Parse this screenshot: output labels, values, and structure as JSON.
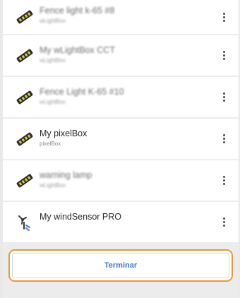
{
  "devices": [
    {
      "name": "Fence light k-65 #8",
      "type": "wLightBox",
      "icon": "led-strip-icon",
      "blurred": true
    },
    {
      "name": "My wLightBox CCT",
      "type": "wLightBox",
      "icon": "led-strip-icon",
      "blurred": true
    },
    {
      "name": "Fence Light K-65 #10",
      "type": "wLightBox",
      "icon": "led-strip-icon",
      "blurred": true
    },
    {
      "name": "My pixelBox",
      "type": "pixelBox",
      "icon": "led-strip-icon",
      "blurred": false
    },
    {
      "name": "warning lamp",
      "type": "wLightBox",
      "icon": "led-strip-icon",
      "blurred": true
    },
    {
      "name": "My windSensor PRO",
      "type": "",
      "icon": "wind-sensor-icon",
      "blurred": false
    }
  ],
  "footer": {
    "finish_label": "Terminar"
  },
  "colors": {
    "accent_orange": "#e59a3c",
    "button_text_blue": "#3c78c8",
    "led_yellow": "#d6c84a"
  }
}
